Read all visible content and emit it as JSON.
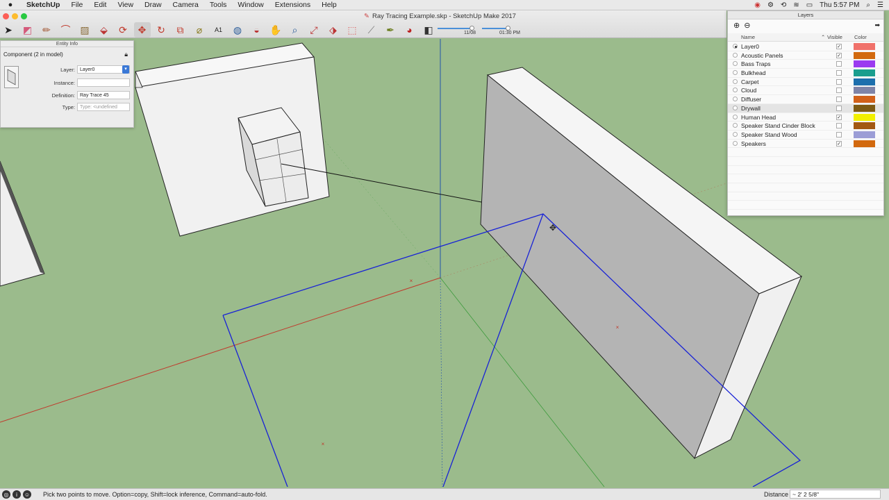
{
  "menubar": {
    "apple": "",
    "items": [
      "SketchUp",
      "File",
      "Edit",
      "View",
      "Draw",
      "Camera",
      "Tools",
      "Window",
      "Extensions",
      "Help"
    ],
    "clock": "Thu 5:57 PM"
  },
  "window": {
    "title": "Ray Tracing Example.skp - SketchUp Make 2017",
    "shadow_date": "11/08",
    "shadow_time": "01:30 PM"
  },
  "toolbar_icons": [
    "select-icon",
    "eraser-icon",
    "pencil-icon",
    "arc-icon",
    "rectangle-icon",
    "push-pull-icon",
    "offset-icon",
    "move-icon",
    "rotate-icon",
    "scale-icon",
    "tape-measure-icon",
    "text-icon",
    "paint-bucket-icon",
    "orbit-icon",
    "pan-icon",
    "zoom-icon",
    "zoom-extents-icon",
    "warehouse-icon",
    "extension-warehouse-icon",
    "tool-x-icon",
    "tool-y-icon",
    "tool-z-icon",
    "tool-w-icon"
  ],
  "entity_info": {
    "title": "Entity Info",
    "header": "Component (2 in model)",
    "layer_label": "Layer:",
    "layer_value": "Layer0",
    "instance_label": "Instance:",
    "instance_value": "",
    "definition_label": "Definition:",
    "definition_value": "Ray Trace 45",
    "type_label": "Type:",
    "type_value": "Type: <undefined"
  },
  "layers": {
    "title": "Layers",
    "col_name": "Name",
    "col_visible": "Visible",
    "col_color": "Color",
    "rows": [
      {
        "name": "Layer0",
        "active": true,
        "visible": true,
        "color": "#f0716a"
      },
      {
        "name": "Acoustic Panels",
        "active": false,
        "visible": true,
        "color": "#d2690e"
      },
      {
        "name": "Bass Traps",
        "active": false,
        "visible": false,
        "color": "#9b3bf0"
      },
      {
        "name": "Bulkhead",
        "active": false,
        "visible": false,
        "color": "#1a9e8e"
      },
      {
        "name": "Carpet",
        "active": false,
        "visible": false,
        "color": "#1d6fad"
      },
      {
        "name": "Cloud",
        "active": false,
        "visible": false,
        "color": "#7f84a8"
      },
      {
        "name": "Diffuser",
        "active": false,
        "visible": false,
        "color": "#d2611a"
      },
      {
        "name": "Drywall",
        "active": false,
        "visible": false,
        "color": "#7d5a14",
        "highlighted": true
      },
      {
        "name": "Human Head",
        "active": false,
        "visible": true,
        "color": "#f2f000"
      },
      {
        "name": "Speaker Stand Cinder Block",
        "active": false,
        "visible": false,
        "color": "#a35812"
      },
      {
        "name": "Speaker Stand Wood",
        "active": false,
        "visible": false,
        "color": "#9b9dd6"
      },
      {
        "name": "Speakers",
        "active": false,
        "visible": true,
        "color": "#d2690e"
      }
    ],
    "check_mark": "✓"
  },
  "status": {
    "message": "Pick two points to move.  Option=copy, Shift=lock inference, Command=auto-fold.",
    "distance_label": "Distance",
    "distance_value": "~ 2' 2 5/8\""
  }
}
